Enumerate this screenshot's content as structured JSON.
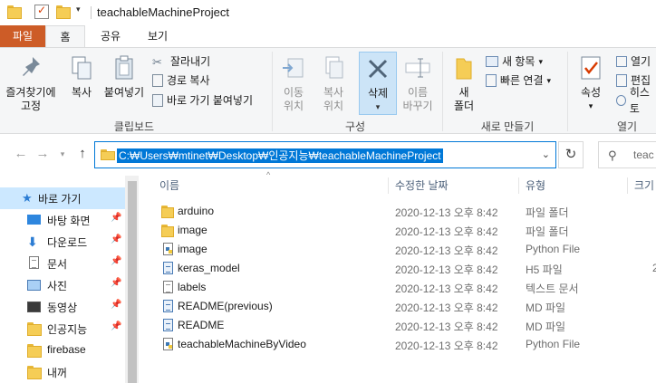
{
  "window": {
    "title": "teachableMachineProject"
  },
  "tabs": {
    "file": "파일",
    "home": "홈",
    "share": "공유",
    "view": "보기"
  },
  "ribbon": {
    "clipboard": {
      "group_label": "클립보드",
      "pin": "즐겨찾기에\n고정",
      "copy": "복사",
      "paste": "붙여넣기",
      "cut": "잘라내기",
      "copy_path": "경로 복사",
      "paste_shortcut": "바로 가기 붙여넣기"
    },
    "organize": {
      "group_label": "구성",
      "move_to": "이동\n위치",
      "copy_to": "복사\n위치",
      "delete": "삭제",
      "rename": "이름\n바꾸기"
    },
    "new": {
      "group_label": "새로 만들기",
      "new_folder": "새\n폴더",
      "new_item": "새 항목",
      "easy_access": "빠른 연결"
    },
    "open": {
      "group_label": "열기",
      "properties": "속성",
      "open": "열기",
      "edit": "편집",
      "history": "히스토"
    }
  },
  "address": {
    "path": "C:₩Users₩mtinet₩Desktop₩인공지능₩teachableMachineProject",
    "search_placeholder": "teac"
  },
  "sidebar": {
    "quick_access": "바로 가기",
    "items": [
      {
        "label": "바탕 화면",
        "pinned": true,
        "icon": "desktop-icon"
      },
      {
        "label": "다운로드",
        "pinned": true,
        "icon": "download-icon"
      },
      {
        "label": "문서",
        "pinned": true,
        "icon": "documents-icon"
      },
      {
        "label": "사진",
        "pinned": true,
        "icon": "pictures-icon"
      },
      {
        "label": "동영상",
        "pinned": true,
        "icon": "videos-icon"
      },
      {
        "label": "인공지능",
        "pinned": true,
        "icon": "folder-icon"
      },
      {
        "label": "firebase",
        "pinned": false,
        "icon": "folder-icon"
      },
      {
        "label": "내꺼",
        "pinned": false,
        "icon": "folder-icon"
      }
    ]
  },
  "columns": {
    "name": "이름",
    "modified": "수정한 날짜",
    "type": "유형",
    "size": "크기"
  },
  "files": [
    {
      "name": "arduino",
      "modified": "2020-12-13 오후 8:42",
      "type": "파일 폴더",
      "size": "",
      "icon": "folder-icon"
    },
    {
      "name": "image",
      "modified": "2020-12-13 오후 8:42",
      "type": "파일 폴더",
      "size": "",
      "icon": "folder-icon"
    },
    {
      "name": "image",
      "modified": "2020-12-13 오후 8:42",
      "type": "Python File",
      "size": "",
      "icon": "python-file-icon"
    },
    {
      "name": "keras_model",
      "modified": "2020-12-13 오후 8:42",
      "type": "H5 파일",
      "size": "2",
      "icon": "h5-file-icon"
    },
    {
      "name": "labels",
      "modified": "2020-12-13 오후 8:42",
      "type": "텍스트 문서",
      "size": "",
      "icon": "text-file-icon"
    },
    {
      "name": "README(previous)",
      "modified": "2020-12-13 오후 8:42",
      "type": "MD 파일",
      "size": "",
      "icon": "md-file-icon"
    },
    {
      "name": "README",
      "modified": "2020-12-13 오후 8:42",
      "type": "MD 파일",
      "size": "",
      "icon": "md-file-icon"
    },
    {
      "name": "teachableMachineByVideo",
      "modified": "2020-12-13 오후 8:42",
      "type": "Python File",
      "size": "",
      "icon": "python-file-icon"
    }
  ]
}
